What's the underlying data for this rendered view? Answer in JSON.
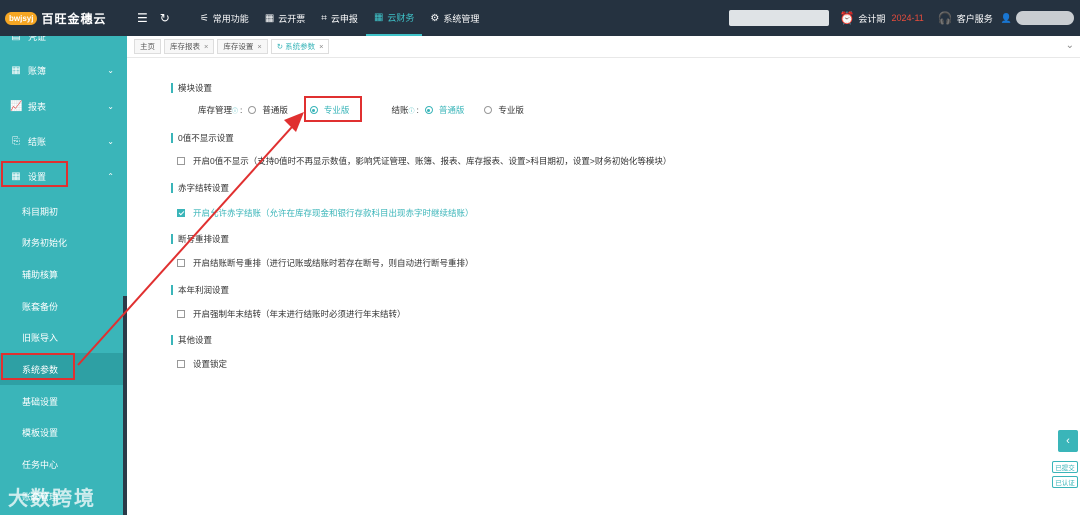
{
  "app": {
    "logo_badge": "bwjsyj",
    "logo_text": "百旺金穗云"
  },
  "topbar": {
    "menu": [
      {
        "label": "常用功能",
        "icon": "sliders-icon"
      },
      {
        "label": "云开票",
        "icon": "grid-icon"
      },
      {
        "label": "云申报",
        "icon": "crop-icon"
      },
      {
        "label": "云财务",
        "icon": "grid-icon",
        "active": true
      },
      {
        "label": "系统管理",
        "icon": "gear-icon"
      }
    ],
    "period_label": "会计期",
    "period_value": "2024-11",
    "service_label": "客户服务"
  },
  "sidebar": {
    "top_partial": "凭证",
    "groups": [
      {
        "label": "账簿"
      },
      {
        "label": "报表"
      },
      {
        "label": "结账"
      },
      {
        "label": "设置"
      }
    ],
    "sub_items": [
      "科目期初",
      "财务初始化",
      "辅助核算",
      "账套备份",
      "旧账导入",
      "系统参数",
      "基础设置",
      "模板设置",
      "任务中心",
      "账套管理"
    ]
  },
  "tabs": [
    {
      "label": "主页"
    },
    {
      "label": "库存报表"
    },
    {
      "label": "库存设置"
    },
    {
      "label": "系统参数"
    }
  ],
  "settings": {
    "module_title": "模块设置",
    "inventory_label": "库存管理",
    "normal_label": "普通版",
    "pro_label": "专业版",
    "closing_label": "结账",
    "zero_title": "0值不显示设置",
    "zero_text": "开启0值不显示（支持0值时不再显示数值，影响凭证管理、账簿、报表、库存报表、设置>科目期初，设置>财务初始化等模块）",
    "red_title": "赤字结转设置",
    "red_text": "开启允许赤字结账（允许在库存现金和银行存款科目出现赤字时继续结账）",
    "gap_title": "断号重排设置",
    "gap_text": "开启结账断号重排（进行记账或结账时若存在断号，则自动进行断号重排）",
    "profit_title": "本年利润设置",
    "profit_text": "开启强制年末结转（年末进行结账时必须进行年末结转）",
    "other_title": "其他设置",
    "lock_text": "设置锁定"
  },
  "right_panel": {
    "btn1": "已提交",
    "btn2": "已认证"
  },
  "watermark": "大数跨境",
  "colors": {
    "accent": "#3ab5b9",
    "topbar": "#253240",
    "highlight": "#e03030",
    "period": "#e74c3c"
  }
}
